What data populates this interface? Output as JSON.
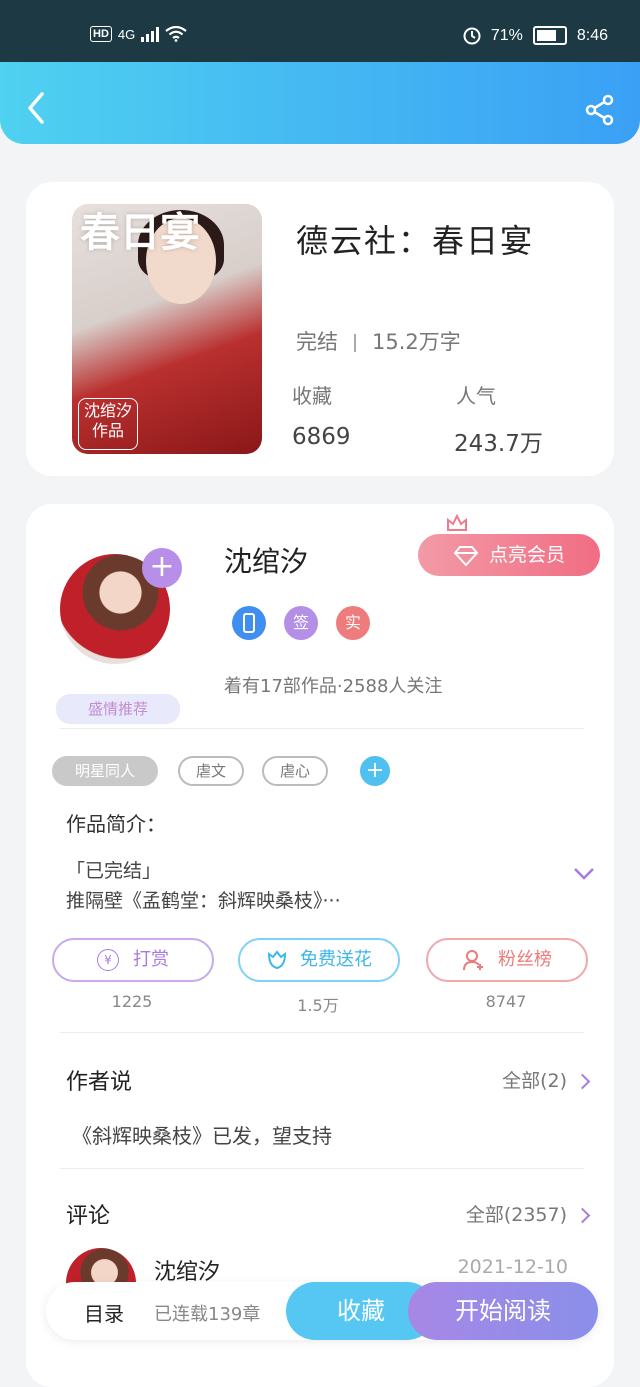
{
  "status_bar": {
    "hd": "HD",
    "network": "4G",
    "battery_percent": "71%",
    "time": "8:46"
  },
  "book": {
    "title": "德云社：春日宴",
    "status": "完结",
    "word_count": "15.2万字",
    "collect_label": "收藏",
    "collect_value": "6869",
    "popularity_label": "人气",
    "popularity_value": "243.7万",
    "cover_title": "春日宴",
    "cover_badge_author": "沈绾汐",
    "cover_badge_label": "作品"
  },
  "author": {
    "name": "沈绾汐",
    "vip_button": "点亮会员",
    "badges": [
      "签",
      "实"
    ],
    "info": "着有17部作品·2588人关注",
    "banner": "盛情推荐",
    "tags": [
      "明星同人",
      "虐文",
      "虐心"
    ]
  },
  "intro": {
    "title": "作品简介：",
    "line1": "「已完结」",
    "line2": "推隔壁《孟鹤堂：斜辉映桑枝》···"
  },
  "actions": [
    {
      "label": "打赏",
      "count": "1225",
      "color": "#b48be0"
    },
    {
      "label": "免费送花",
      "count": "1.5万",
      "color": "#4fc0ef"
    },
    {
      "label": "粉丝榜",
      "count": "8747",
      "color": "#ef8a8a"
    }
  ],
  "author_says": {
    "title": "作者说",
    "more": "全部(2)",
    "text": "《斜辉映桑枝》已发，望支持"
  },
  "comments": {
    "title": "评论",
    "more": "全部(2357)",
    "first_name": "沈绾汐",
    "first_date": "2021-12-10"
  },
  "bottom_bar": {
    "catalog": "目录",
    "serial": "已连载139章",
    "collect": "收藏",
    "read": "开始阅读"
  }
}
